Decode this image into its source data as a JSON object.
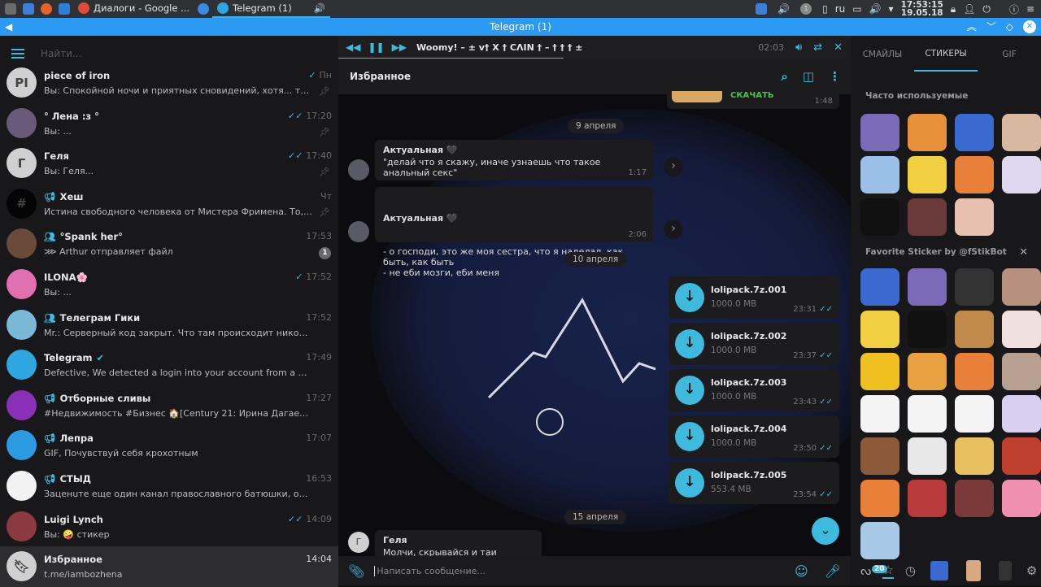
{
  "taskbar": {
    "tasks": [
      {
        "label": "Диалоги - Google ..."
      },
      {
        "label": "Telegram (1)"
      }
    ],
    "lang": "ru",
    "time": "17:53:15",
    "date": "19.05.18",
    "notif_count": "1"
  },
  "window": {
    "title": "Telegram (1)"
  },
  "sidebar": {
    "search_placeholder": "Найти...",
    "chats": [
      {
        "name": "piece of iron",
        "initials": "PI",
        "msg": "Вы: Спокойной ночи и приятных сновидений, хотя... ты наверн...",
        "time": "Пн",
        "check": "✓",
        "pinned": true,
        "avatar": "#d0d0d0"
      },
      {
        "name": "° Лена :з °",
        "msg": "Вы: ...",
        "time": "17:20",
        "check": "✓✓",
        "pinned": true,
        "avatar": "#6a5a7a"
      },
      {
        "name": "Геля",
        "initials": "Г",
        "msg": "Вы: Геля...",
        "time": "17:40",
        "check": "✓✓",
        "pinned": true,
        "avatar": "#d0d0d0"
      },
      {
        "name": "Хеш",
        "initials": "#",
        "msg": "Истина свободного человека от Мистера Фримена. То, что мен...",
        "time": "Чт",
        "channel": true,
        "pinned": true,
        "avatar": "#050505"
      },
      {
        "name": "°Spank her°",
        "msg": "⋙ Arthur отправляет файл",
        "time": "17:53",
        "group": true,
        "unread": "1",
        "avatar": "#6a4a3a"
      },
      {
        "name": "ILONA🌸",
        "msg": "Вы: ...",
        "time": "17:52",
        "check": "✓",
        "avatar": "#e070b0"
      },
      {
        "name": "Телеграм Гики",
        "msg": "Mr.: Серверный код закрыт. Что там происходит никому не известн...",
        "time": "17:52",
        "group": true,
        "avatar": "#7ab8d8"
      },
      {
        "name": "Telegram",
        "msg": "Defective,  We detected a login into your account from a new device on ...",
        "time": "17:49",
        "verified": true,
        "avatar": "#2ea6e0"
      },
      {
        "name": "Отборные сливы",
        "msg": "#Недвижимость #Бизнес  🏠[Century 21: Ирина Дагаева] Риски при...",
        "time": "17:27",
        "channel": true,
        "avatar": "#8a2fb8"
      },
      {
        "name": "Лепра",
        "msg": "GIF, Почувствуй себя крохотным",
        "time": "17:07",
        "channel": true,
        "avatar": "#2b9ae0"
      },
      {
        "name": "СТЫД",
        "msg": "Заценuте еще один канал православного батюшки, от вступления ...",
        "time": "16:53",
        "channel": true,
        "avatar": "#f2f2f2"
      },
      {
        "name": "Luigi Lynch",
        "msg": "Вы: 🤪 стикер",
        "time": "14:09",
        "check": "✓✓",
        "avatar": "#8a3a40"
      },
      {
        "name": "Избранное",
        "msg": "t.me/iambozhena",
        "time": "14:04",
        "selected": true,
        "avatar": "#d0d0d0"
      }
    ]
  },
  "player": {
    "track": "Woomy! – ± v† X † CΛIN † – † † † ±",
    "time": "02:03",
    "progress": 0.44
  },
  "chat": {
    "title": "Избранное",
    "partial": {
      "download_label": "СКАЧАТЬ",
      "time": "1:48"
    },
    "dates": [
      "9 апреля",
      "10 апреля",
      "15 апреля"
    ],
    "messages": [
      {
        "author": "Актуальная 🖤",
        "text": "\"делай что я скажу, иначе узнаешь что такое анальный секс\"",
        "time": "1:17"
      },
      {
        "author": "Актуальная 🖤",
        "text": "- о господи, это же моя сестра, что я наделал, как быть, как быть\n- не еби мозги, еби меня",
        "time": "2:06"
      }
    ],
    "files": [
      {
        "name": "lolipack.7z.001",
        "size": "1000.0 MB",
        "time": "23:31"
      },
      {
        "name": "lolipack.7z.002",
        "size": "1000.0 MB",
        "time": "23:37"
      },
      {
        "name": "lolipack.7z.003",
        "size": "1000.0 MB",
        "time": "23:43"
      },
      {
        "name": "lolipack.7z.004",
        "size": "1000.0 MB",
        "time": "23:50"
      },
      {
        "name": "lolipack.7z.005",
        "size": "553.4 MB",
        "time": "23:54"
      }
    ],
    "last": {
      "initial": "Г",
      "author": "Геля",
      "text": "Молчи, скрывайся и таи"
    },
    "input_placeholder": "Написать сообщение..."
  },
  "stickers": {
    "tabs": [
      "СМАЙЛЫ",
      "СТИКЕРЫ",
      "GIF"
    ],
    "active_tab": 1,
    "sections": [
      "Часто используемые",
      "Favorite Sticker by @fStikBot"
    ],
    "pack_count": "20",
    "recent_colors": [
      "#7a6ab8",
      "#e8903a",
      "#3a6ad0",
      "#d8b8a0",
      "#9ac0e8",
      "#f0d040",
      "#e8803a",
      "#e0d8f0",
      "#111111",
      "#6a3a3a",
      "#e8c0b0"
    ],
    "favorite_colors": [
      "#3a6ad0",
      "#7a6ab8",
      "#333333",
      "#b89080",
      "#f0d040",
      "#111111",
      "#c08a4a",
      "#f0e0e0",
      "#f0c020",
      "#e8a040",
      "#e8803a",
      "#b8a090",
      "#f4f4f4",
      "#f4f4f4",
      "#f4f4f4",
      "#d8d0f0",
      "#8a5a3a",
      "#e8e8e8",
      "#e8c060",
      "#c04030",
      "#e8803a",
      "#b83a3a",
      "#7a3a3a",
      "#f090b0",
      "#a8c8e8"
    ]
  }
}
